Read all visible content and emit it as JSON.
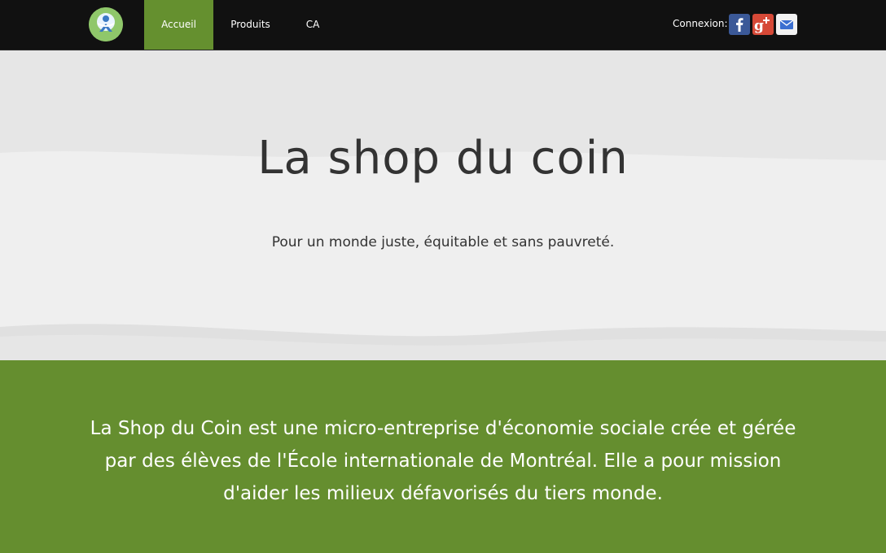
{
  "nav": {
    "items": [
      {
        "label": "Accueil",
        "active": true
      },
      {
        "label": "Produits",
        "active": false
      },
      {
        "label": "CA",
        "active": false
      }
    ],
    "connexion_label": "Connexion:",
    "social_icons": [
      "facebook-icon",
      "google-plus-icon",
      "email-icon"
    ]
  },
  "hero": {
    "title": "La shop du coin",
    "subtitle": "Pour un monde juste, équitable et sans pauvreté."
  },
  "about": {
    "text": "La Shop du Coin est une micro-entreprise d'économie sociale crée et gérée par des élèves de l'École internationale de Montréal. Elle a pour mission d'aider les milieux défavorisés du tiers monde."
  },
  "colors": {
    "navbar_bg": "#111111",
    "accent_green": "#658e2f",
    "hero_bg": "#ececec",
    "text_dark": "#333333"
  }
}
